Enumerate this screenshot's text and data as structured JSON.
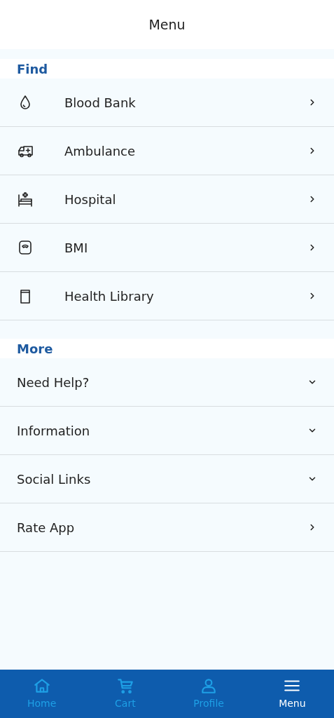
{
  "header": {
    "title": "Menu"
  },
  "sections": [
    {
      "title": "Find",
      "items": [
        {
          "label": "Blood Bank",
          "kind": "link"
        },
        {
          "label": "Ambulance",
          "kind": "link"
        },
        {
          "label": "Hospital",
          "kind": "link"
        },
        {
          "label": "BMI",
          "kind": "link"
        },
        {
          "label": "Health Library",
          "kind": "link"
        }
      ]
    },
    {
      "title": "More",
      "items": [
        {
          "label": "Need Help?",
          "kind": "accordion"
        },
        {
          "label": "Information",
          "kind": "accordion"
        },
        {
          "label": "Social Links",
          "kind": "accordion"
        },
        {
          "label": "Rate App",
          "kind": "link"
        }
      ]
    }
  ],
  "bottom_nav": [
    {
      "label": "Home",
      "selected": false
    },
    {
      "label": "Cart",
      "selected": false
    },
    {
      "label": "Profile",
      "selected": false
    },
    {
      "label": "Menu",
      "selected": true
    }
  ]
}
